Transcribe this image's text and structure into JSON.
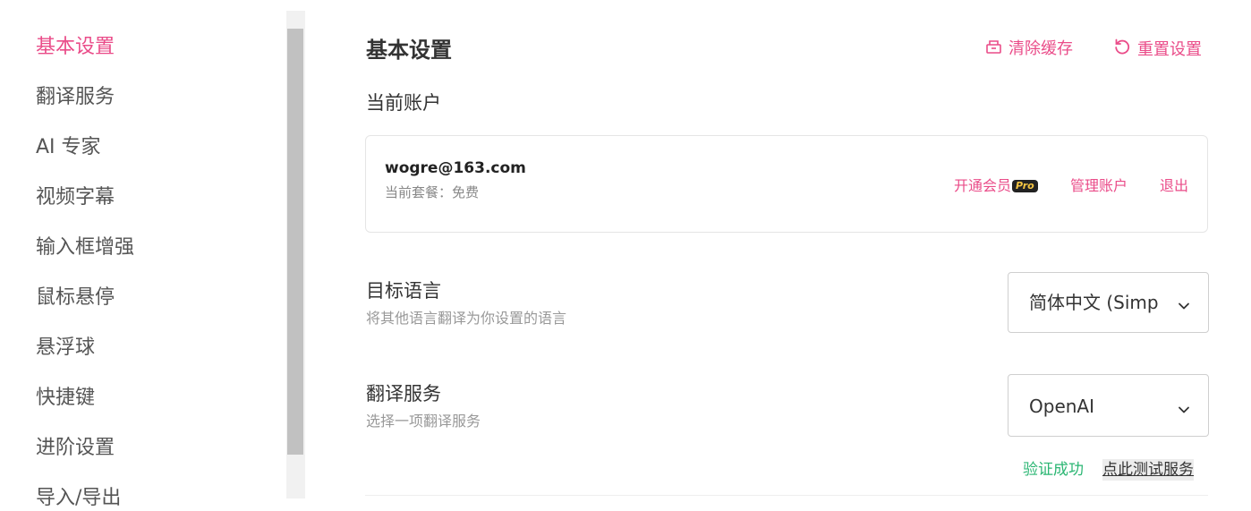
{
  "sidebar": {
    "items": [
      {
        "label": "基本设置",
        "active": true
      },
      {
        "label": "翻译服务"
      },
      {
        "label": "AI 专家"
      },
      {
        "label": "视频字幕"
      },
      {
        "label": "输入框增强"
      },
      {
        "label": "鼠标悬停"
      },
      {
        "label": "悬浮球"
      },
      {
        "label": "快捷键"
      },
      {
        "label": "进阶设置"
      },
      {
        "label": "导入/导出"
      }
    ]
  },
  "header": {
    "title": "基本设置",
    "clear_cache_label": "清除缓存",
    "clear_cache_icon": "cache-box-icon",
    "reset_label": "重置设置",
    "reset_icon": "reset-icon"
  },
  "account": {
    "section_label": "当前账户",
    "email": "wogre@163.com",
    "plan": "当前套餐：免费",
    "upgrade_label": "开通会员",
    "pro_badge": "Pro",
    "manage_label": "管理账户",
    "logout_label": "退出"
  },
  "target_language": {
    "title": "目标语言",
    "description": "将其他语言翻译为你设置的语言",
    "value": "简体中文 (Simplified Chinese)",
    "chevron_icon": "chevron-down-icon"
  },
  "translation_service": {
    "title": "翻译服务",
    "description": "选择一项翻译服务",
    "value": "OpenAI",
    "chevron_icon": "chevron-down-icon",
    "status": "验证成功",
    "test_label": "点此测试服务"
  },
  "colors": {
    "accent": "#ea4c89",
    "success": "#2bb673"
  }
}
